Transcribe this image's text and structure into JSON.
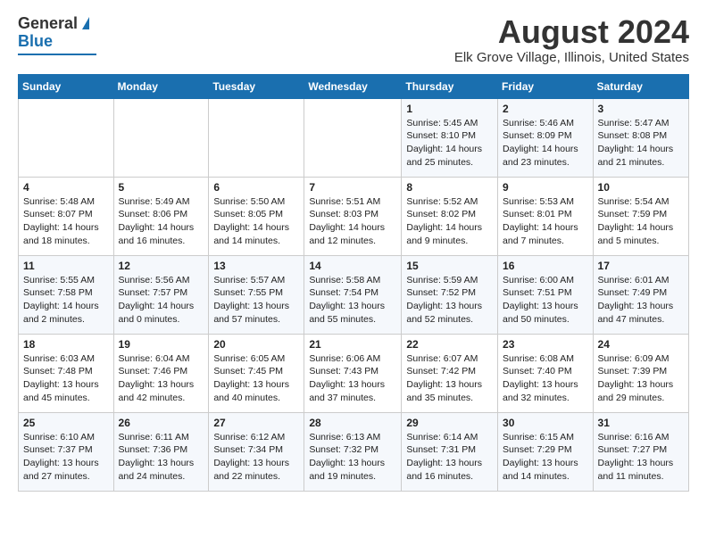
{
  "header": {
    "logo_general": "General",
    "logo_blue": "Blue",
    "main_title": "August 2024",
    "sub_title": "Elk Grove Village, Illinois, United States"
  },
  "calendar": {
    "days_of_week": [
      "Sunday",
      "Monday",
      "Tuesday",
      "Wednesday",
      "Thursday",
      "Friday",
      "Saturday"
    ],
    "weeks": [
      [
        {
          "day": "",
          "info": ""
        },
        {
          "day": "",
          "info": ""
        },
        {
          "day": "",
          "info": ""
        },
        {
          "day": "",
          "info": ""
        },
        {
          "day": "1",
          "info": "Sunrise: 5:45 AM\nSunset: 8:10 PM\nDaylight: 14 hours\nand 25 minutes."
        },
        {
          "day": "2",
          "info": "Sunrise: 5:46 AM\nSunset: 8:09 PM\nDaylight: 14 hours\nand 23 minutes."
        },
        {
          "day": "3",
          "info": "Sunrise: 5:47 AM\nSunset: 8:08 PM\nDaylight: 14 hours\nand 21 minutes."
        }
      ],
      [
        {
          "day": "4",
          "info": "Sunrise: 5:48 AM\nSunset: 8:07 PM\nDaylight: 14 hours\nand 18 minutes."
        },
        {
          "day": "5",
          "info": "Sunrise: 5:49 AM\nSunset: 8:06 PM\nDaylight: 14 hours\nand 16 minutes."
        },
        {
          "day": "6",
          "info": "Sunrise: 5:50 AM\nSunset: 8:05 PM\nDaylight: 14 hours\nand 14 minutes."
        },
        {
          "day": "7",
          "info": "Sunrise: 5:51 AM\nSunset: 8:03 PM\nDaylight: 14 hours\nand 12 minutes."
        },
        {
          "day": "8",
          "info": "Sunrise: 5:52 AM\nSunset: 8:02 PM\nDaylight: 14 hours\nand 9 minutes."
        },
        {
          "day": "9",
          "info": "Sunrise: 5:53 AM\nSunset: 8:01 PM\nDaylight: 14 hours\nand 7 minutes."
        },
        {
          "day": "10",
          "info": "Sunrise: 5:54 AM\nSunset: 7:59 PM\nDaylight: 14 hours\nand 5 minutes."
        }
      ],
      [
        {
          "day": "11",
          "info": "Sunrise: 5:55 AM\nSunset: 7:58 PM\nDaylight: 14 hours\nand 2 minutes."
        },
        {
          "day": "12",
          "info": "Sunrise: 5:56 AM\nSunset: 7:57 PM\nDaylight: 14 hours\nand 0 minutes."
        },
        {
          "day": "13",
          "info": "Sunrise: 5:57 AM\nSunset: 7:55 PM\nDaylight: 13 hours\nand 57 minutes."
        },
        {
          "day": "14",
          "info": "Sunrise: 5:58 AM\nSunset: 7:54 PM\nDaylight: 13 hours\nand 55 minutes."
        },
        {
          "day": "15",
          "info": "Sunrise: 5:59 AM\nSunset: 7:52 PM\nDaylight: 13 hours\nand 52 minutes."
        },
        {
          "day": "16",
          "info": "Sunrise: 6:00 AM\nSunset: 7:51 PM\nDaylight: 13 hours\nand 50 minutes."
        },
        {
          "day": "17",
          "info": "Sunrise: 6:01 AM\nSunset: 7:49 PM\nDaylight: 13 hours\nand 47 minutes."
        }
      ],
      [
        {
          "day": "18",
          "info": "Sunrise: 6:03 AM\nSunset: 7:48 PM\nDaylight: 13 hours\nand 45 minutes."
        },
        {
          "day": "19",
          "info": "Sunrise: 6:04 AM\nSunset: 7:46 PM\nDaylight: 13 hours\nand 42 minutes."
        },
        {
          "day": "20",
          "info": "Sunrise: 6:05 AM\nSunset: 7:45 PM\nDaylight: 13 hours\nand 40 minutes."
        },
        {
          "day": "21",
          "info": "Sunrise: 6:06 AM\nSunset: 7:43 PM\nDaylight: 13 hours\nand 37 minutes."
        },
        {
          "day": "22",
          "info": "Sunrise: 6:07 AM\nSunset: 7:42 PM\nDaylight: 13 hours\nand 35 minutes."
        },
        {
          "day": "23",
          "info": "Sunrise: 6:08 AM\nSunset: 7:40 PM\nDaylight: 13 hours\nand 32 minutes."
        },
        {
          "day": "24",
          "info": "Sunrise: 6:09 AM\nSunset: 7:39 PM\nDaylight: 13 hours\nand 29 minutes."
        }
      ],
      [
        {
          "day": "25",
          "info": "Sunrise: 6:10 AM\nSunset: 7:37 PM\nDaylight: 13 hours\nand 27 minutes."
        },
        {
          "day": "26",
          "info": "Sunrise: 6:11 AM\nSunset: 7:36 PM\nDaylight: 13 hours\nand 24 minutes."
        },
        {
          "day": "27",
          "info": "Sunrise: 6:12 AM\nSunset: 7:34 PM\nDaylight: 13 hours\nand 22 minutes."
        },
        {
          "day": "28",
          "info": "Sunrise: 6:13 AM\nSunset: 7:32 PM\nDaylight: 13 hours\nand 19 minutes."
        },
        {
          "day": "29",
          "info": "Sunrise: 6:14 AM\nSunset: 7:31 PM\nDaylight: 13 hours\nand 16 minutes."
        },
        {
          "day": "30",
          "info": "Sunrise: 6:15 AM\nSunset: 7:29 PM\nDaylight: 13 hours\nand 14 minutes."
        },
        {
          "day": "31",
          "info": "Sunrise: 6:16 AM\nSunset: 7:27 PM\nDaylight: 13 hours\nand 11 minutes."
        }
      ]
    ]
  }
}
